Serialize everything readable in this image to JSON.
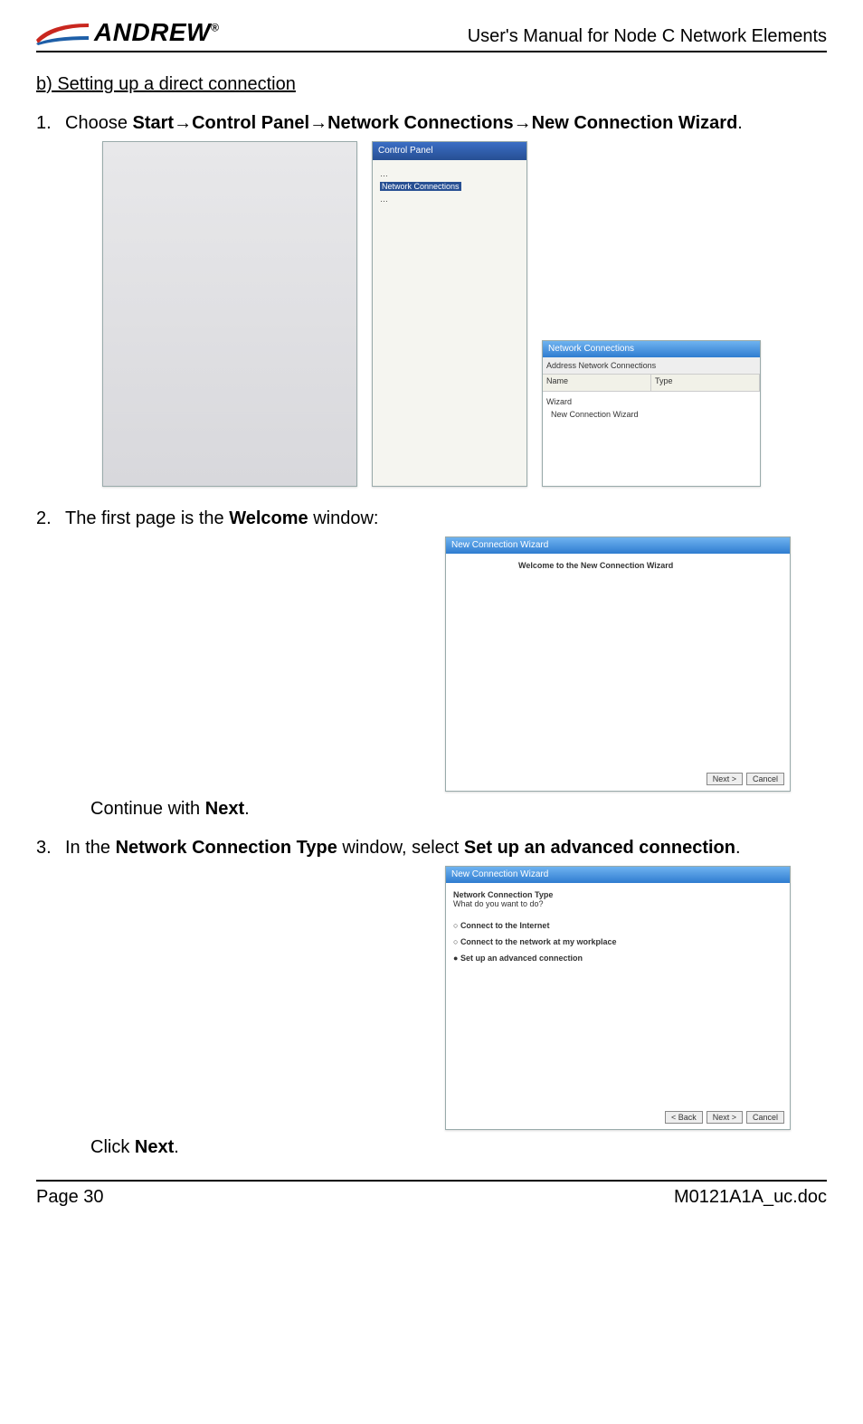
{
  "header": {
    "logo_text": "ANDREW",
    "doc_title": "User's Manual for Node C Network Elements"
  },
  "section_heading": "b) Setting up a direct connection",
  "steps": {
    "s1": {
      "num": "1.",
      "prefix": "Choose ",
      "path_start": "Start",
      "arrow": "→",
      "path_cp": "Control Panel",
      "path_nc": "Network Connections",
      "path_ncw": "New Connection Wizard",
      "suffix": "."
    },
    "s2": {
      "num": "2.",
      "text_prefix": "The first page is the ",
      "bold": "Welcome",
      "text_suffix": " window:",
      "action_prefix": "Continue with ",
      "action_bold": "Next",
      "action_suffix": "."
    },
    "s3": {
      "num": "3.",
      "text_prefix": "In the ",
      "bold1": "Network Connection Type",
      "text_mid": " window, select ",
      "bold2": "Set up an advanced connection",
      "text_suffix": ".",
      "action_prefix": "Click ",
      "action_bold": "Next",
      "action_suffix": "."
    }
  },
  "screenshots": {
    "control_panel_title": "Control Panel",
    "network_connections_title": "Network Connections",
    "address_label": "Address",
    "net_addr_value": "Network Connections",
    "col_name": "Name",
    "col_type": "Type",
    "wizard_label": "Wizard",
    "ncw_item": "New Connection Wizard",
    "wiz1_title": "New Connection Wizard",
    "wiz1_heading": "Welcome to the New Connection Wizard",
    "wiz2_title": "New Connection Wizard",
    "wiz2_heading": "Network Connection Type",
    "wiz2_sub": "What do you want to do?",
    "opt1": "Connect to the Internet",
    "opt2": "Connect to the network at my workplace",
    "opt3": "Set up an advanced connection",
    "btn_back": "< Back",
    "btn_next": "Next >",
    "btn_cancel": "Cancel"
  },
  "footer": {
    "page": "Page 30",
    "docref": "M0121A1A_uc.doc"
  }
}
